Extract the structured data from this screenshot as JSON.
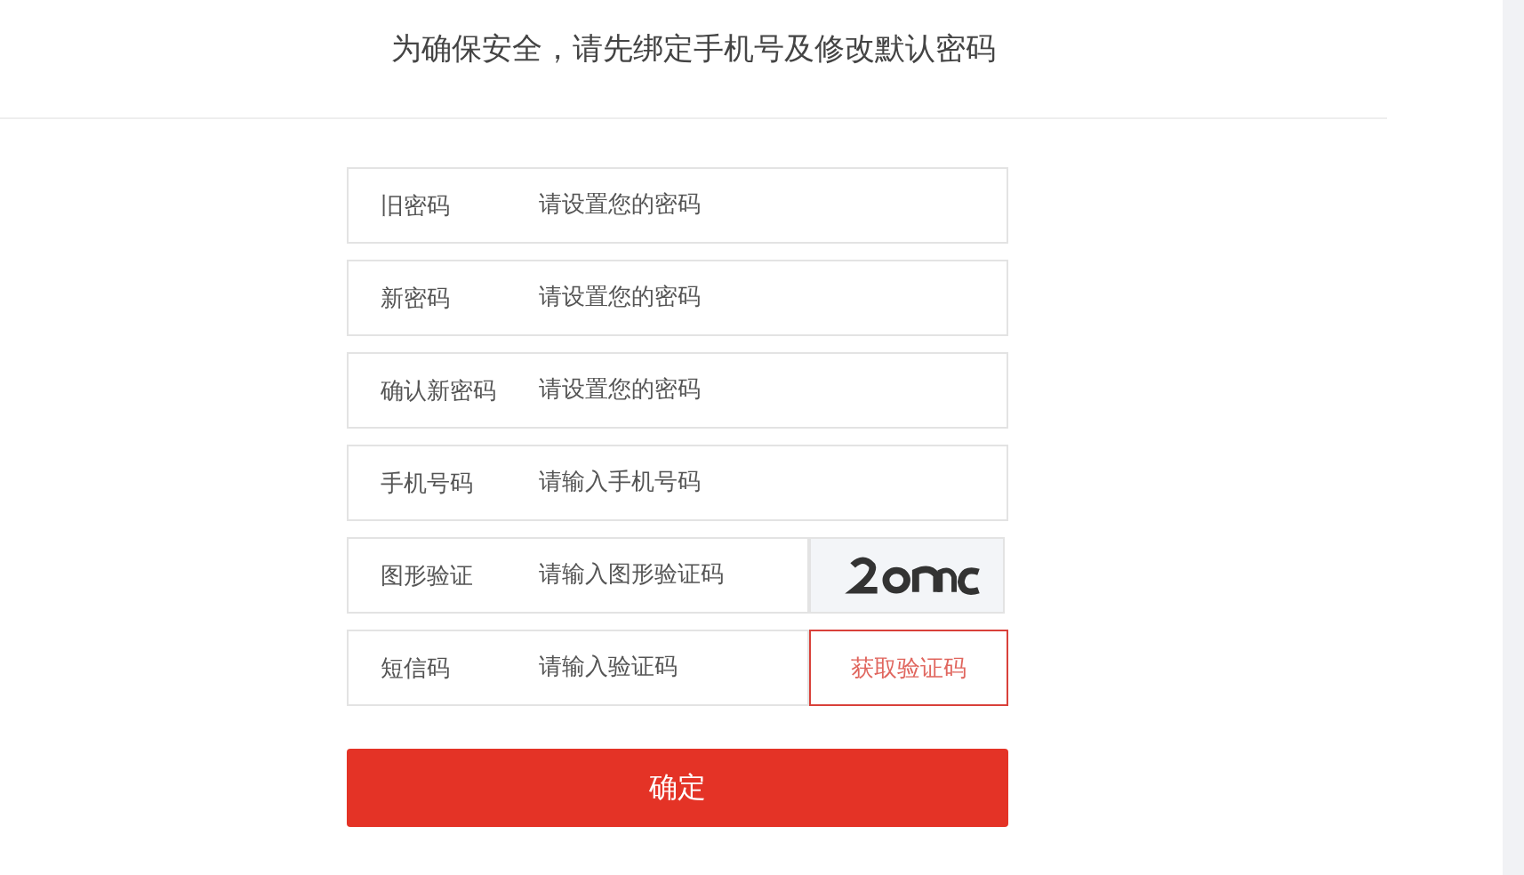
{
  "heading": "为确保安全，请先绑定手机号及修改默认密码",
  "fields": [
    {
      "kind": "plain",
      "label": "旧密码",
      "placeholder": "请设置您的密码"
    },
    {
      "kind": "plain",
      "label": "新密码",
      "placeholder": "请设置您的密码"
    },
    {
      "kind": "plain",
      "label": "确认新密码",
      "placeholder": "请设置您的密码"
    },
    {
      "kind": "plain",
      "label": "手机号码",
      "placeholder": "请输入手机号码"
    },
    {
      "kind": "captcha",
      "label": "图形验证",
      "placeholder": "请输入图形验证码"
    },
    {
      "kind": "sms",
      "label": "短信码",
      "placeholder": "请输入验证码",
      "action": "获取验证码"
    }
  ],
  "submit": "确定"
}
